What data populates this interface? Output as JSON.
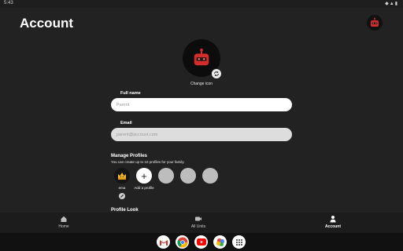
{
  "status_bar": {
    "time": "5:43",
    "icons": "◆▲▮"
  },
  "header": {
    "title": "Account",
    "avatar_icon": "robot-avatar-icon"
  },
  "avatar": {
    "icon": "robot-avatar-icon",
    "edit_icon": "refresh-icon",
    "change_label": "Change icon"
  },
  "form": {
    "name_label": "Full name",
    "name_placeholder": "Parent",
    "email_label": "Email",
    "email_placeholder": "parent@account.com"
  },
  "profiles": {
    "title": "Manage Profiles",
    "subtitle": "You can create up to 10 profiles for your family.",
    "items": [
      {
        "label": "ema",
        "icon": "crown-avatar-icon"
      },
      {
        "label": "Add a profile",
        "icon": "plus-icon"
      },
      {
        "label": "",
        "icon": "empty-slot"
      },
      {
        "label": "",
        "icon": "empty-slot"
      },
      {
        "label": "",
        "icon": "empty-slot"
      }
    ]
  },
  "profile_look": {
    "title": "Profile Look"
  },
  "bottom_nav": [
    {
      "label": "Home",
      "icon": "home-icon",
      "active": false
    },
    {
      "label": "All Units",
      "icon": "video-icon",
      "active": false
    },
    {
      "label": "Account",
      "icon": "person-icon",
      "active": true
    }
  ],
  "taskbar": [
    {
      "app": "gmail-icon"
    },
    {
      "app": "chrome-icon"
    },
    {
      "app": "youtube-icon"
    },
    {
      "app": "photos-icon"
    },
    {
      "app": "app-drawer-icon"
    }
  ],
  "colors": {
    "background": "#222222",
    "accent_red": "#d62b2b",
    "field_bg": "#ffffff",
    "field_disabled": "#dddddd"
  }
}
